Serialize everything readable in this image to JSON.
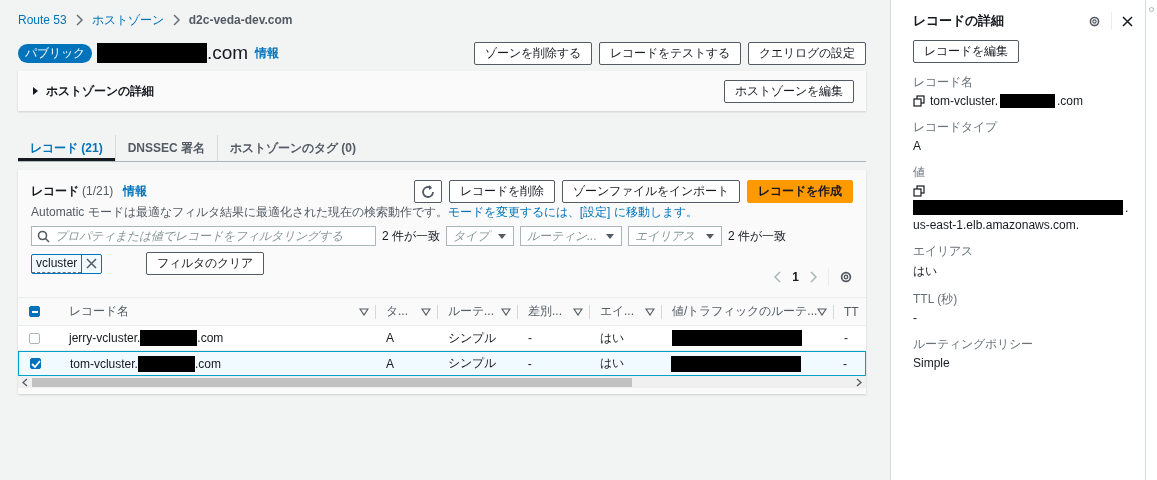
{
  "breadcrumbs": [
    {
      "label": "Route 53",
      "link": true
    },
    {
      "label": "ホストゾーン",
      "link": true
    },
    {
      "label": "d2c-veda-dev.com",
      "link": false
    }
  ],
  "zone": {
    "badge": "パブリック",
    "name_redacted": true,
    "name_suffix": ".com",
    "info": "情報",
    "buttons": [
      "ゾーンを削除する",
      "レコードをテストする",
      "クエリログの設定"
    ]
  },
  "details": {
    "title": "ホストゾーンの詳細",
    "expanded": false,
    "button": "ホストゾーンを編集"
  },
  "tabs": [
    {
      "label": "レコード (21)",
      "selected": true
    },
    {
      "label": "DNSSEC 署名",
      "selected": false
    },
    {
      "label": "ホストゾーンのタグ (0)",
      "selected": false
    }
  ],
  "records": {
    "title": "レコード",
    "count": "(1/21)",
    "info": "情報",
    "description": "Automatic モードは最適なフィルタ結果に最適化された現在の検索動作です。",
    "description_link": "モードを変更するには、[設定] に移動します。",
    "buttons": [
      {
        "kind": "refresh"
      },
      {
        "kind": "normal",
        "label": "レコードを削除"
      },
      {
        "kind": "normal",
        "label": "ゾーンファイルをインポート"
      },
      {
        "kind": "primary",
        "label": "レコードを作成"
      }
    ],
    "filter": {
      "placeholder": "プロパティまたは値でレコードをフィルタリングする",
      "match_count": "2 件が一致",
      "dropdowns": [
        "タイプ",
        "ルーティン...",
        "エイリアス"
      ],
      "match_count_2": "2 件が一致"
    },
    "tokens": [
      "vcluster"
    ],
    "clear_button": "フィルタのクリア",
    "page": "1",
    "header_indeterminate": true,
    "columns": [
      "レコード名",
      "タ...",
      "ルーテ...",
      "差別...",
      "エイ...",
      "値/トラフィックのルーテ...",
      "TT"
    ],
    "rows": [
      {
        "selected": false,
        "name_prefix": "jerry-vcluster.",
        "name_redacted": true,
        "name_suffix": ".com",
        "type": "A",
        "routing": "シンプル",
        "differentiator": "-",
        "alias": "はい",
        "value_redacted": true,
        "ttl": "-"
      },
      {
        "selected": true,
        "name_prefix": "tom-vcluster.",
        "name_redacted": true,
        "name_suffix": ".com",
        "type": "A",
        "routing": "シンプル",
        "differentiator": "-",
        "alias": "はい",
        "value_redacted": true,
        "ttl": "-"
      }
    ]
  },
  "side_panel": {
    "title": "レコードの詳細",
    "edit_button": "レコードを編集",
    "fields": [
      {
        "label": "レコード名",
        "kind": "copy_inline",
        "prefix": "tom-vcluster.",
        "redacted": true,
        "suffix": ".com"
      },
      {
        "label": "レコードタイプ",
        "kind": "plain",
        "suffix": "A"
      },
      {
        "label": "値",
        "kind": "copy_block",
        "redacted": true,
        "suffix": ".",
        "next_line": "us-east-1.elb.amazonaws.com."
      },
      {
        "label": "エイリアス",
        "kind": "plain",
        "suffix": "はい"
      },
      {
        "label": "TTL (秒)",
        "kind": "plain",
        "suffix": "-"
      },
      {
        "label": "ルーティングポリシー",
        "kind": "plain",
        "suffix": "Simple"
      }
    ]
  }
}
